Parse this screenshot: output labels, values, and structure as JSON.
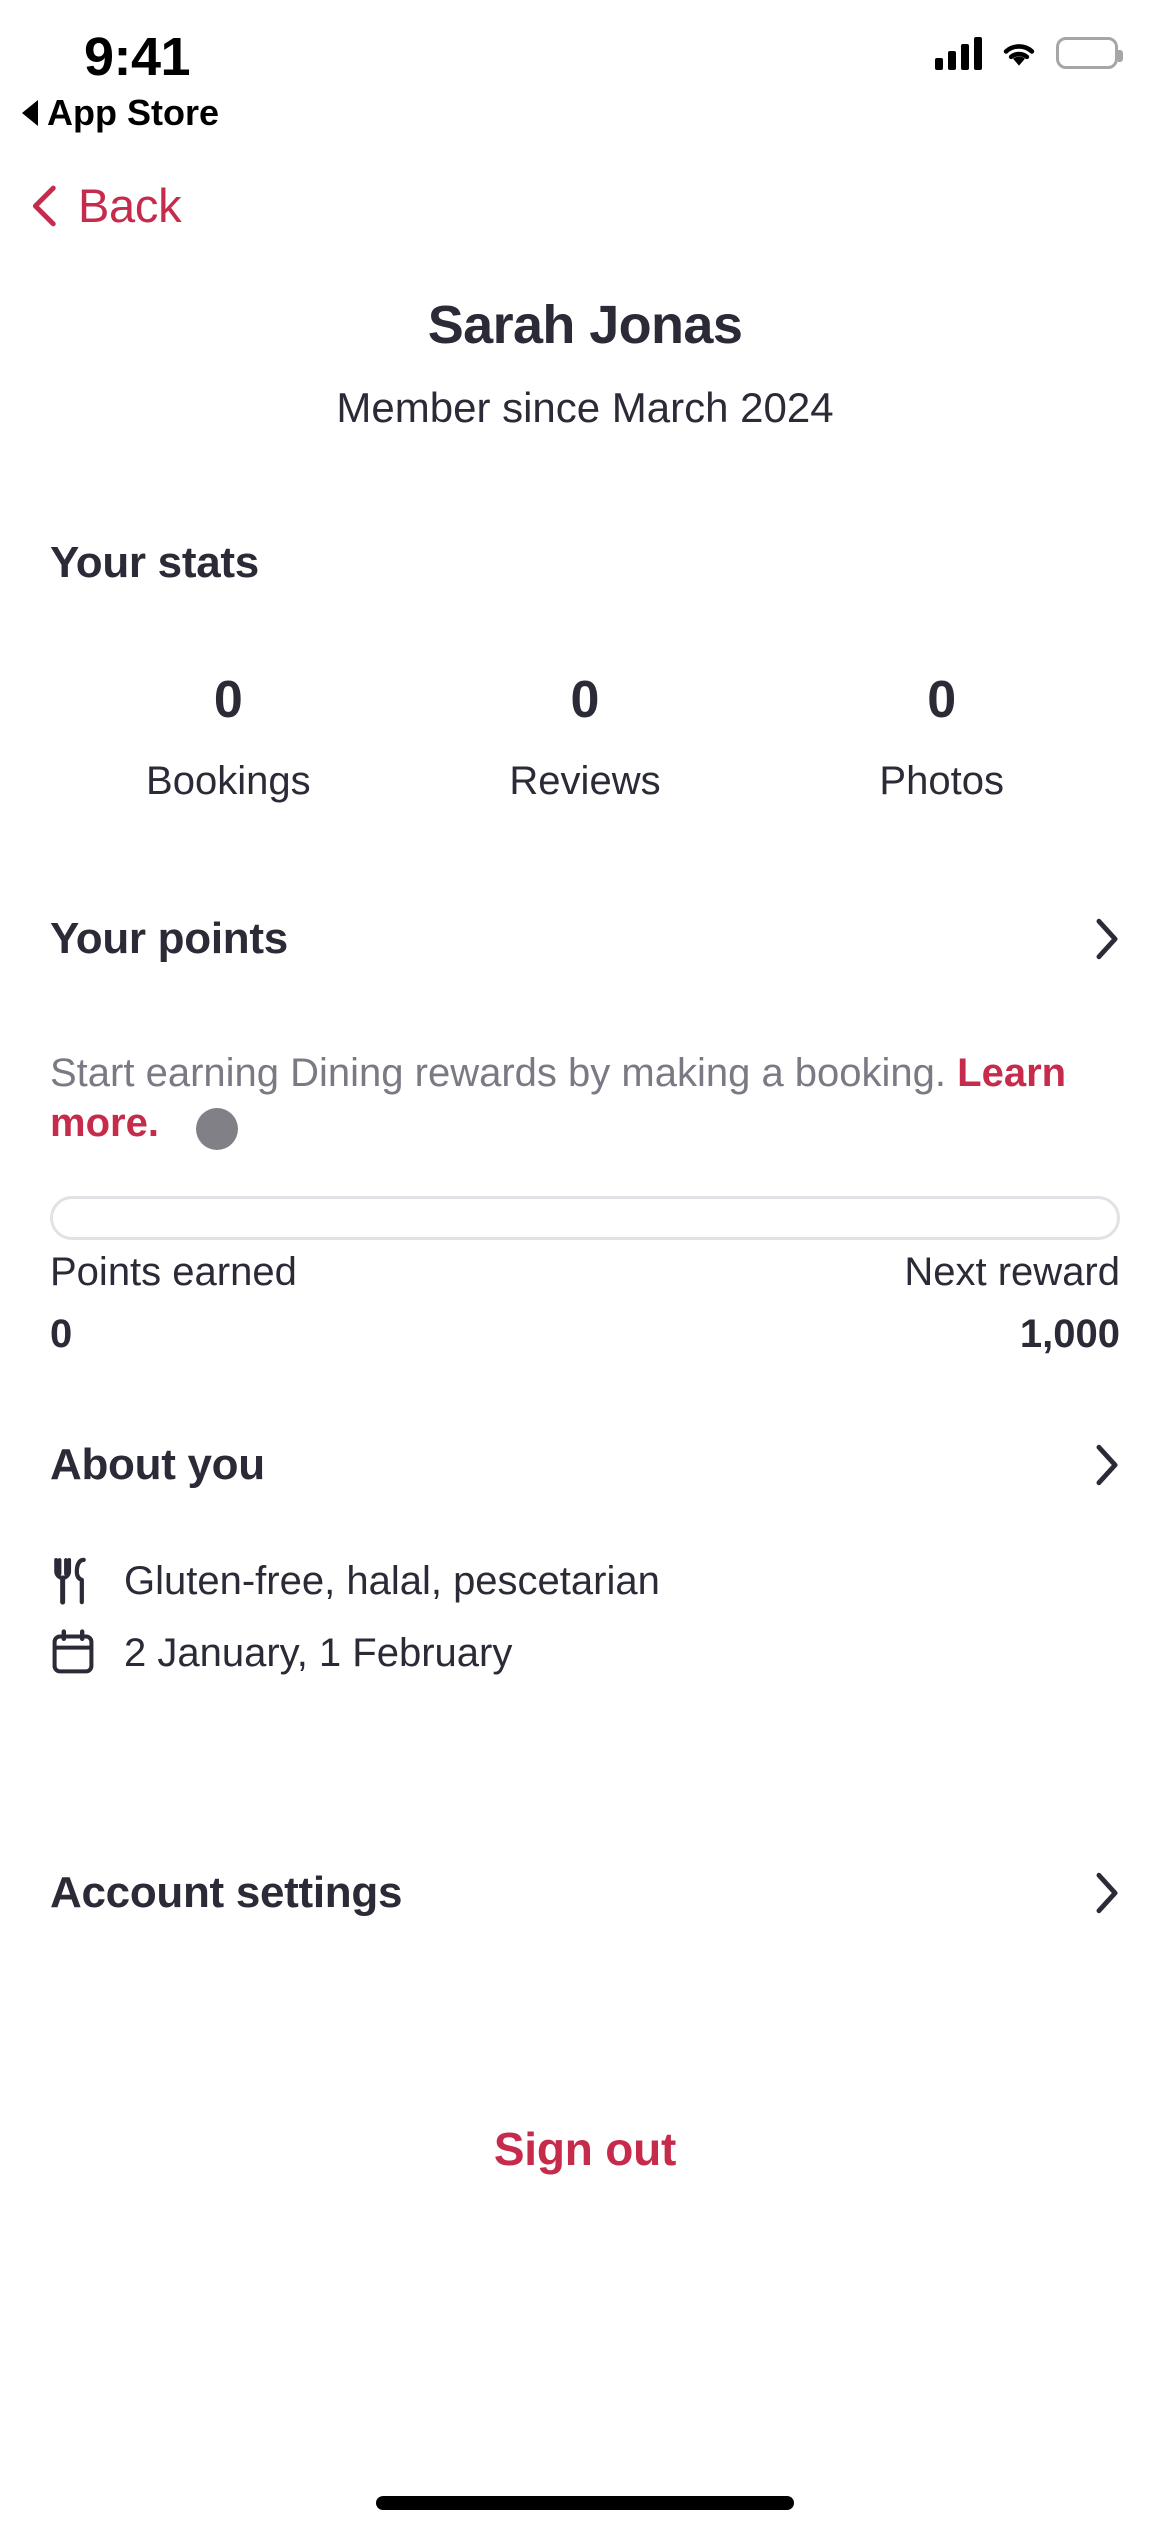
{
  "status_bar": {
    "time": "9:41",
    "return_app": "App Store",
    "return_icon": "back-triangle-icon",
    "signal_icon": "cellular-signal-icon",
    "wifi_icon": "wifi-icon",
    "battery_icon": "battery-full-icon"
  },
  "nav": {
    "back_label": "Back",
    "back_icon": "chevron-left-icon",
    "accent_color": "#C62B4C"
  },
  "profile": {
    "name": "Sarah Jonas",
    "member_since": "Member since March 2024"
  },
  "stats": {
    "title": "Your stats",
    "items": [
      {
        "value": "0",
        "label": "Bookings"
      },
      {
        "value": "0",
        "label": "Reviews"
      },
      {
        "value": "0",
        "label": "Photos"
      }
    ]
  },
  "points": {
    "title": "Your points",
    "chevron_icon": "chevron-right-icon",
    "description": "Start earning Dining rewards by making a booking.",
    "learn_more": "Learn more.",
    "progress_percent": 0,
    "earned_label": "Points earned",
    "earned_value": "0",
    "next_reward_label": "Next reward",
    "next_reward_value": "1,000"
  },
  "about": {
    "title": "About you",
    "chevron_icon": "chevron-right-icon",
    "items": [
      {
        "icon": "cutlery-icon",
        "text": "Gluten-free, halal, pescetarian"
      },
      {
        "icon": "calendar-icon",
        "text": "2 January, 1 February"
      }
    ]
  },
  "account": {
    "title": "Account settings",
    "chevron_icon": "chevron-right-icon"
  },
  "sign_out": {
    "label": "Sign out"
  },
  "colors": {
    "accent": "#C62B4C",
    "text_primary": "#2B2B38",
    "text_muted": "#7A7A85",
    "border": "#E2E2E6"
  }
}
